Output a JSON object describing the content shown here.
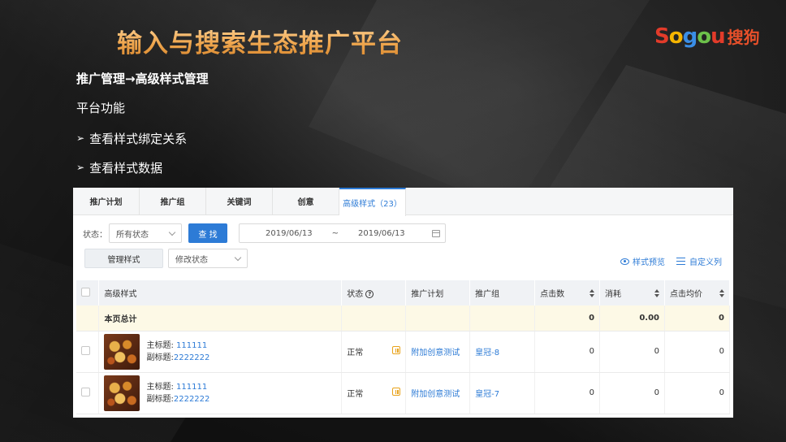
{
  "slide": {
    "title": "输入与搜索生态推广平台",
    "logo": {
      "letters": [
        "S",
        "o",
        "g",
        "o",
        "u"
      ],
      "letter_colors": [
        "#e23b2a",
        "#f5b400",
        "#3a8ee6",
        "#6cc04a",
        "#e23b2a"
      ],
      "cn": "搜狗"
    },
    "heading": "推广管理→高级样式管理",
    "subheading": "平台功能",
    "items": [
      "查看样式绑定关系",
      "查看样式数据"
    ],
    "arrow_glyph": "➢"
  },
  "panel": {
    "tabs": [
      "推广计划",
      "推广组",
      "关键词",
      "创意",
      "高级样式（23）"
    ],
    "active_tab": 4,
    "filters": {
      "status_label": "状态：",
      "status_value": "所有状态",
      "search_label": "查 找",
      "date_start": "2019/06/13",
      "date_sep": "~",
      "date_end": "2019/06/13"
    },
    "actions": {
      "manage_label": "管理样式",
      "modify_status_value": "修改状态",
      "preview_label": "样式预览",
      "custom_cols_label": "自定义列"
    },
    "table": {
      "headers": [
        "高级样式",
        "状态",
        "推广计划",
        "推广组",
        "点击数",
        "消耗",
        "点击均价"
      ],
      "total_label": "本页总计",
      "total_values": [
        "0",
        "0.00",
        "0"
      ],
      "rows": [
        {
          "main_prefix": "主标题: ",
          "main": "111111",
          "sub_prefix": "副标题:",
          "sub": "2222222",
          "status": "正常",
          "plan": "附加创意测试",
          "group": "皇冠-8",
          "clicks": "0",
          "cost": "0",
          "cpc": "0"
        },
        {
          "main_prefix": "主标题: ",
          "main": "111111",
          "sub_prefix": "副标题:",
          "sub": "2222222",
          "status": "正常",
          "plan": "附加创意测试",
          "group": "皇冠-7",
          "clicks": "0",
          "cost": "0",
          "cpc": "0"
        }
      ]
    }
  }
}
